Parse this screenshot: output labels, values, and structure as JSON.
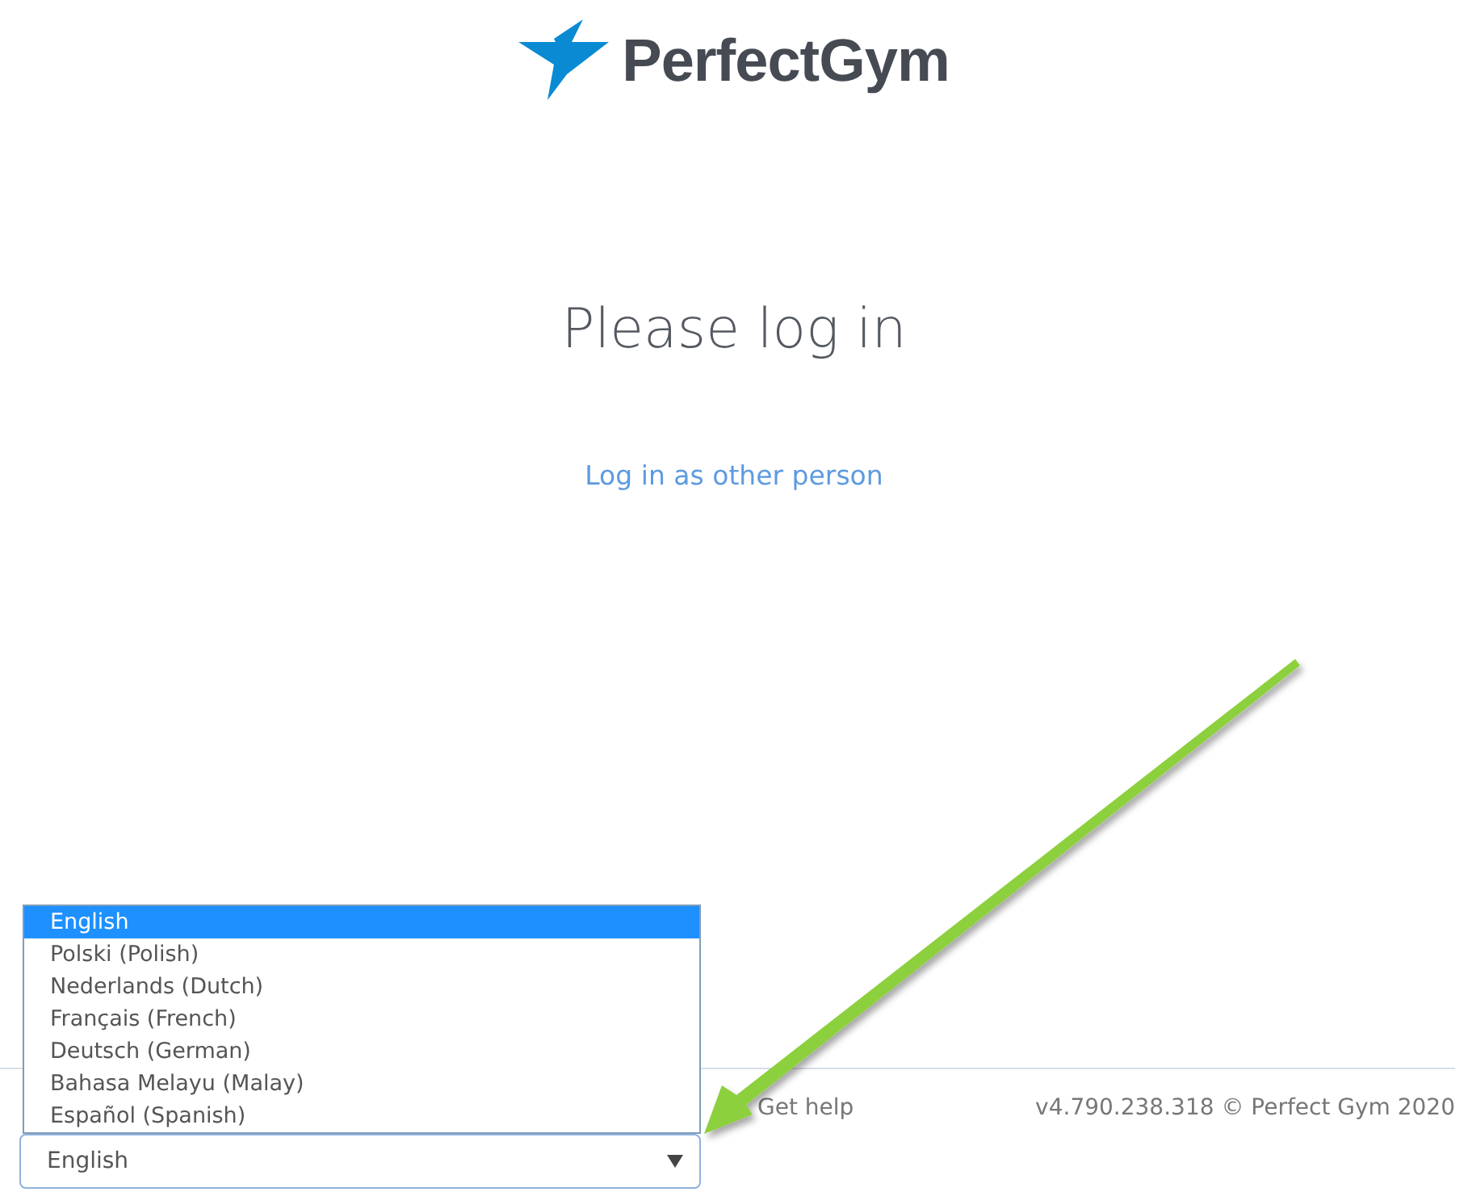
{
  "logo": {
    "text": "PerfectGym"
  },
  "heading": "Please log in",
  "link": "Log in as other person",
  "footer": {
    "help": "Get help",
    "version": "v4.790.238.318 © Perfect Gym 2020"
  },
  "language_select": {
    "value": "English",
    "expanded": true,
    "options": [
      {
        "label": "English",
        "selected": true
      },
      {
        "label": "Polski (Polish)",
        "selected": false
      },
      {
        "label": "Nederlands (Dutch)",
        "selected": false
      },
      {
        "label": "Français (French)",
        "selected": false
      },
      {
        "label": "Deutsch (German)",
        "selected": false
      },
      {
        "label": "Bahasa Melayu (Malay)",
        "selected": false
      },
      {
        "label": "Español (Spanish)",
        "selected": false
      }
    ]
  }
}
